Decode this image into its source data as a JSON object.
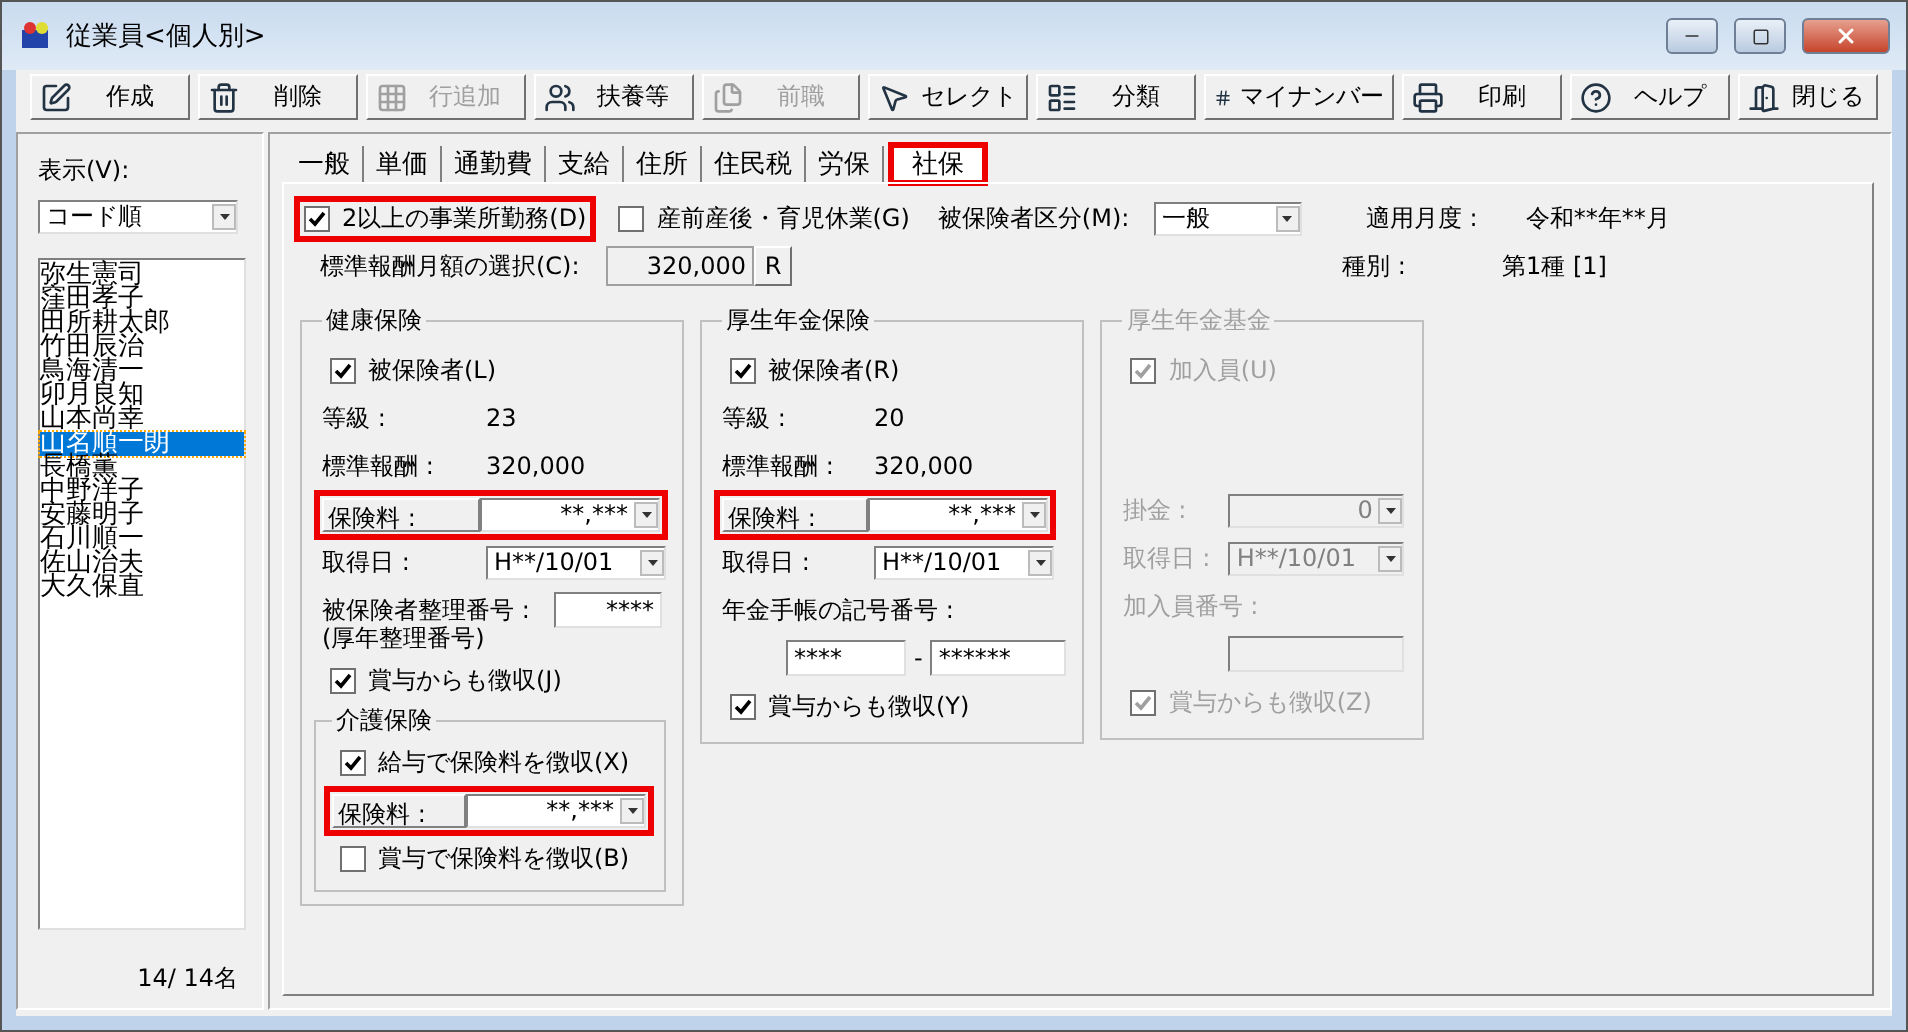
{
  "window": {
    "title": "従業員<個人別>"
  },
  "toolbar": [
    {
      "label": "作成",
      "disabled": false
    },
    {
      "label": "削除",
      "disabled": false
    },
    {
      "label": "行追加",
      "disabled": true
    },
    {
      "label": "扶養等",
      "disabled": false
    },
    {
      "label": "前職",
      "disabled": true
    },
    {
      "label": "セレクト",
      "disabled": false
    },
    {
      "label": "分類",
      "disabled": false
    },
    {
      "label": "マイナンバー",
      "disabled": false
    },
    {
      "label": "印刷",
      "disabled": false
    },
    {
      "label": "ヘルプ",
      "disabled": false
    },
    {
      "label": "閉じる",
      "disabled": false
    }
  ],
  "sidebar": {
    "display_label": "表示(V):",
    "sort": "コード順",
    "employees": [
      {
        "name": "弥生憲司",
        "selected": false
      },
      {
        "name": "窪田孝子",
        "selected": false
      },
      {
        "name": "田所耕太郎",
        "selected": false
      },
      {
        "name": "竹田辰治",
        "selected": false
      },
      {
        "name": "鳥海清一",
        "selected": false
      },
      {
        "name": "卯月良知",
        "selected": false
      },
      {
        "name": "山本尚幸",
        "selected": false
      },
      {
        "name": "山名順一朗",
        "selected": true
      },
      {
        "name": "長橋薫",
        "selected": false
      },
      {
        "name": "中野洋子",
        "selected": false
      },
      {
        "name": "安藤明子",
        "selected": false
      },
      {
        "name": "石川順一",
        "selected": false
      },
      {
        "name": "佐山治夫",
        "selected": false
      },
      {
        "name": "大久保直",
        "selected": false
      }
    ],
    "count": "14/ 14名"
  },
  "tabs": [
    {
      "label": "一般",
      "selected": false
    },
    {
      "label": "単価",
      "selected": false
    },
    {
      "label": "通勤費",
      "selected": false
    },
    {
      "label": "支給",
      "selected": false
    },
    {
      "label": "住所",
      "selected": false
    },
    {
      "label": "住民税",
      "selected": false
    },
    {
      "label": "労保",
      "selected": false
    },
    {
      "label": "社保",
      "selected": true
    }
  ],
  "header": {
    "multi_office": {
      "label": "2以上の事業所勤務(D)",
      "checked": true,
      "highlighted": true
    },
    "maternity": {
      "label": "産前産後・育児休業(G)",
      "checked": false
    },
    "insured_category": {
      "label": "被保険者区分(M):",
      "value": "一般"
    },
    "applied_month": {
      "label": "適用月度 :",
      "value": "令和**年**月"
    },
    "remuneration_choice": {
      "label": "標準報酬月額の選択(C):",
      "value": "320,000",
      "button": "R"
    },
    "class": {
      "label": "種別 :",
      "value": "第1種 [1]"
    }
  },
  "groups": [
    {
      "kind": "health",
      "title": "健康保険",
      "disabled": false,
      "rows": [
        {
          "kind": "checkbox",
          "label": "被保険者(L)",
          "checked": true
        },
        {
          "kind": "pair",
          "label": "等級 :",
          "value": "23"
        },
        {
          "kind": "pair",
          "label": "標準報酬 :",
          "value": "320,000"
        },
        {
          "kind": "select",
          "label": "保険料 :",
          "value": "**,***",
          "highlighted": true
        },
        {
          "kind": "select",
          "label": "取得日 :",
          "value": "H**/10/01",
          "highlighted": false
        },
        {
          "kind": "field",
          "label": "被保険者整理番号 :",
          "value": "****",
          "note": "(厚年整理番号)"
        },
        {
          "kind": "checkbox",
          "label": "賞与からも徴収(J)",
          "checked": true
        },
        {
          "kind": "subgroup",
          "title": "介護保険",
          "rows": [
            {
              "kind": "checkbox",
              "label": "給与で保険料を徴収(X)",
              "checked": true
            },
            {
              "kind": "select",
              "label": "保険料 :",
              "value": "**,***",
              "highlighted": true
            },
            {
              "kind": "checkbox",
              "label": "賞与で保険料を徴収(B)",
              "checked": false
            }
          ]
        }
      ]
    },
    {
      "kind": "pension",
      "title": "厚生年金保険",
      "disabled": false,
      "rows": [
        {
          "kind": "checkbox",
          "label": "被保険者(R)",
          "checked": true
        },
        {
          "kind": "pair",
          "label": "等級 :",
          "value": "20"
        },
        {
          "kind": "pair",
          "label": "標準報酬 :",
          "value": "320,000"
        },
        {
          "kind": "select",
          "label": "保険料 :",
          "value": "**,***",
          "highlighted": true
        },
        {
          "kind": "select",
          "label": "取得日 :",
          "value": "H**/10/01",
          "highlighted": false
        },
        {
          "kind": "split",
          "label": "年金手帳の記号番号 :",
          "values": [
            "****",
            "******"
          ],
          "separator": "-"
        },
        {
          "kind": "checkbox",
          "label": "賞与からも徴収(Y)",
          "checked": true
        }
      ]
    },
    {
      "kind": "fund",
      "title": "厚生年金基金",
      "disabled": true,
      "rows": [
        {
          "kind": "checkbox",
          "label": "加入員(U)",
          "checked": true
        },
        {
          "kind": "select",
          "label": "掛金 :",
          "value": "0",
          "highlighted": false
        },
        {
          "kind": "select",
          "label": "取得日 :",
          "value": "H**/10/01",
          "highlighted": false
        },
        {
          "kind": "blank",
          "label": "加入員番号 :"
        },
        {
          "kind": "checkbox",
          "label": "賞与からも徴収(Z)",
          "checked": true
        }
      ]
    }
  ]
}
